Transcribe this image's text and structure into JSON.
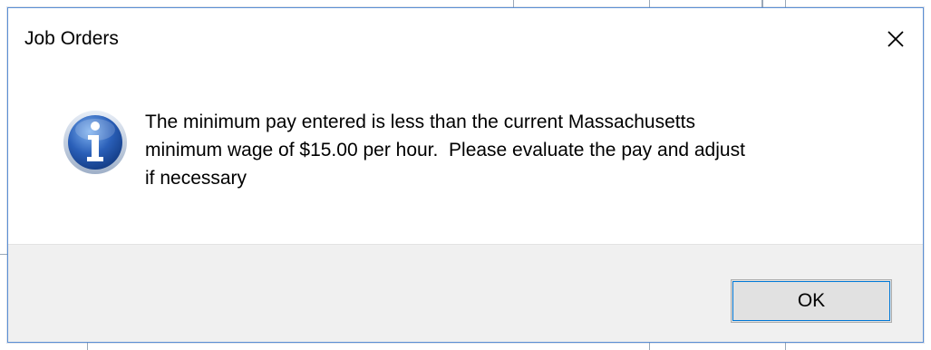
{
  "dialog": {
    "title": "Job Orders",
    "close_icon": "close-icon",
    "message_icon": "info-icon",
    "message_lines": [
      "The minimum pay entered is less than the current Massachusetts",
      "minimum wage of $15.00 per hour.  Please evaluate the pay and adjust",
      "if necessary"
    ],
    "ok_label": "OK"
  },
  "colors": {
    "border": "#5b8fd4",
    "footer_bg": "#f0f0f0",
    "button_bg": "#e1e1e1",
    "focus": "#0078d7",
    "icon_blue": "#2a5fb8"
  }
}
